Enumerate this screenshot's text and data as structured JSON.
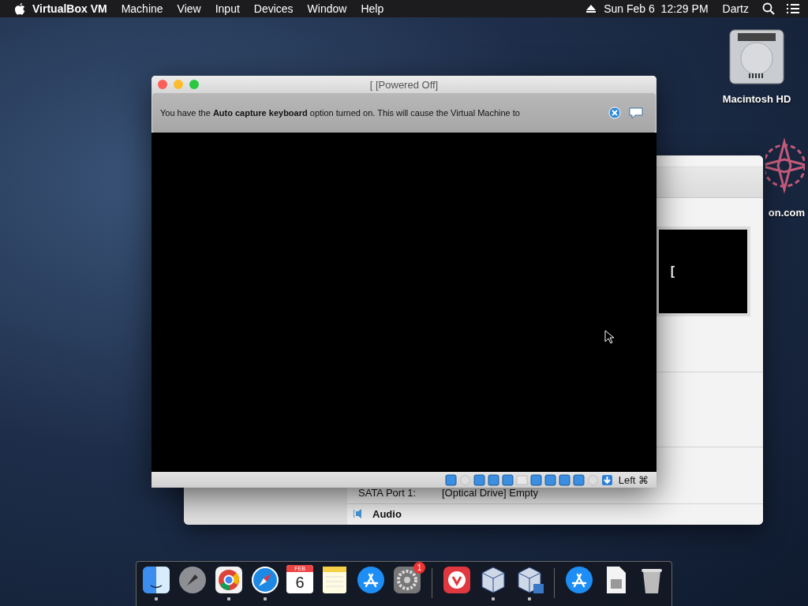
{
  "menubar": {
    "app_name": "VirtualBox VM",
    "menus": [
      "Machine",
      "View",
      "Input",
      "Devices",
      "Window",
      "Help"
    ],
    "clock": "Sun Feb 6  12:29 PM",
    "user": "Dartz"
  },
  "desktop_icons": [
    {
      "kind": "drive",
      "label": "Macintosh HD"
    },
    {
      "kind": "flower",
      "label": "on.com"
    }
  ],
  "background_window": {
    "preview_text": "[",
    "storage_row": {
      "label": "SATA Port 1:",
      "value": "[Optical Drive] Empty"
    },
    "section": "Audio"
  },
  "vm_window": {
    "title": "[ [Powered Off]",
    "notice": "You have the **Auto capture keyboard** option turned on. This will cause the Virtual Machine to",
    "host_key": "Left ⌘"
  },
  "dock": [
    {
      "kind": "finder",
      "running": true
    },
    {
      "kind": "launchpad",
      "running": false
    },
    {
      "kind": "chrome",
      "running": true
    },
    {
      "kind": "safari",
      "running": true
    },
    {
      "kind": "calendar",
      "running": false,
      "month": "FEB",
      "day": "6"
    },
    {
      "kind": "notes",
      "running": false
    },
    {
      "kind": "appstore",
      "running": false
    },
    {
      "kind": "settings",
      "running": false,
      "badge": "1"
    },
    {
      "kind": "separator"
    },
    {
      "kind": "vivaldi",
      "running": false
    },
    {
      "kind": "cube",
      "running": true
    },
    {
      "kind": "cube-window",
      "running": true
    },
    {
      "kind": "separator"
    },
    {
      "kind": "appstore",
      "running": false
    },
    {
      "kind": "document",
      "running": false
    },
    {
      "kind": "trash",
      "running": false
    }
  ]
}
